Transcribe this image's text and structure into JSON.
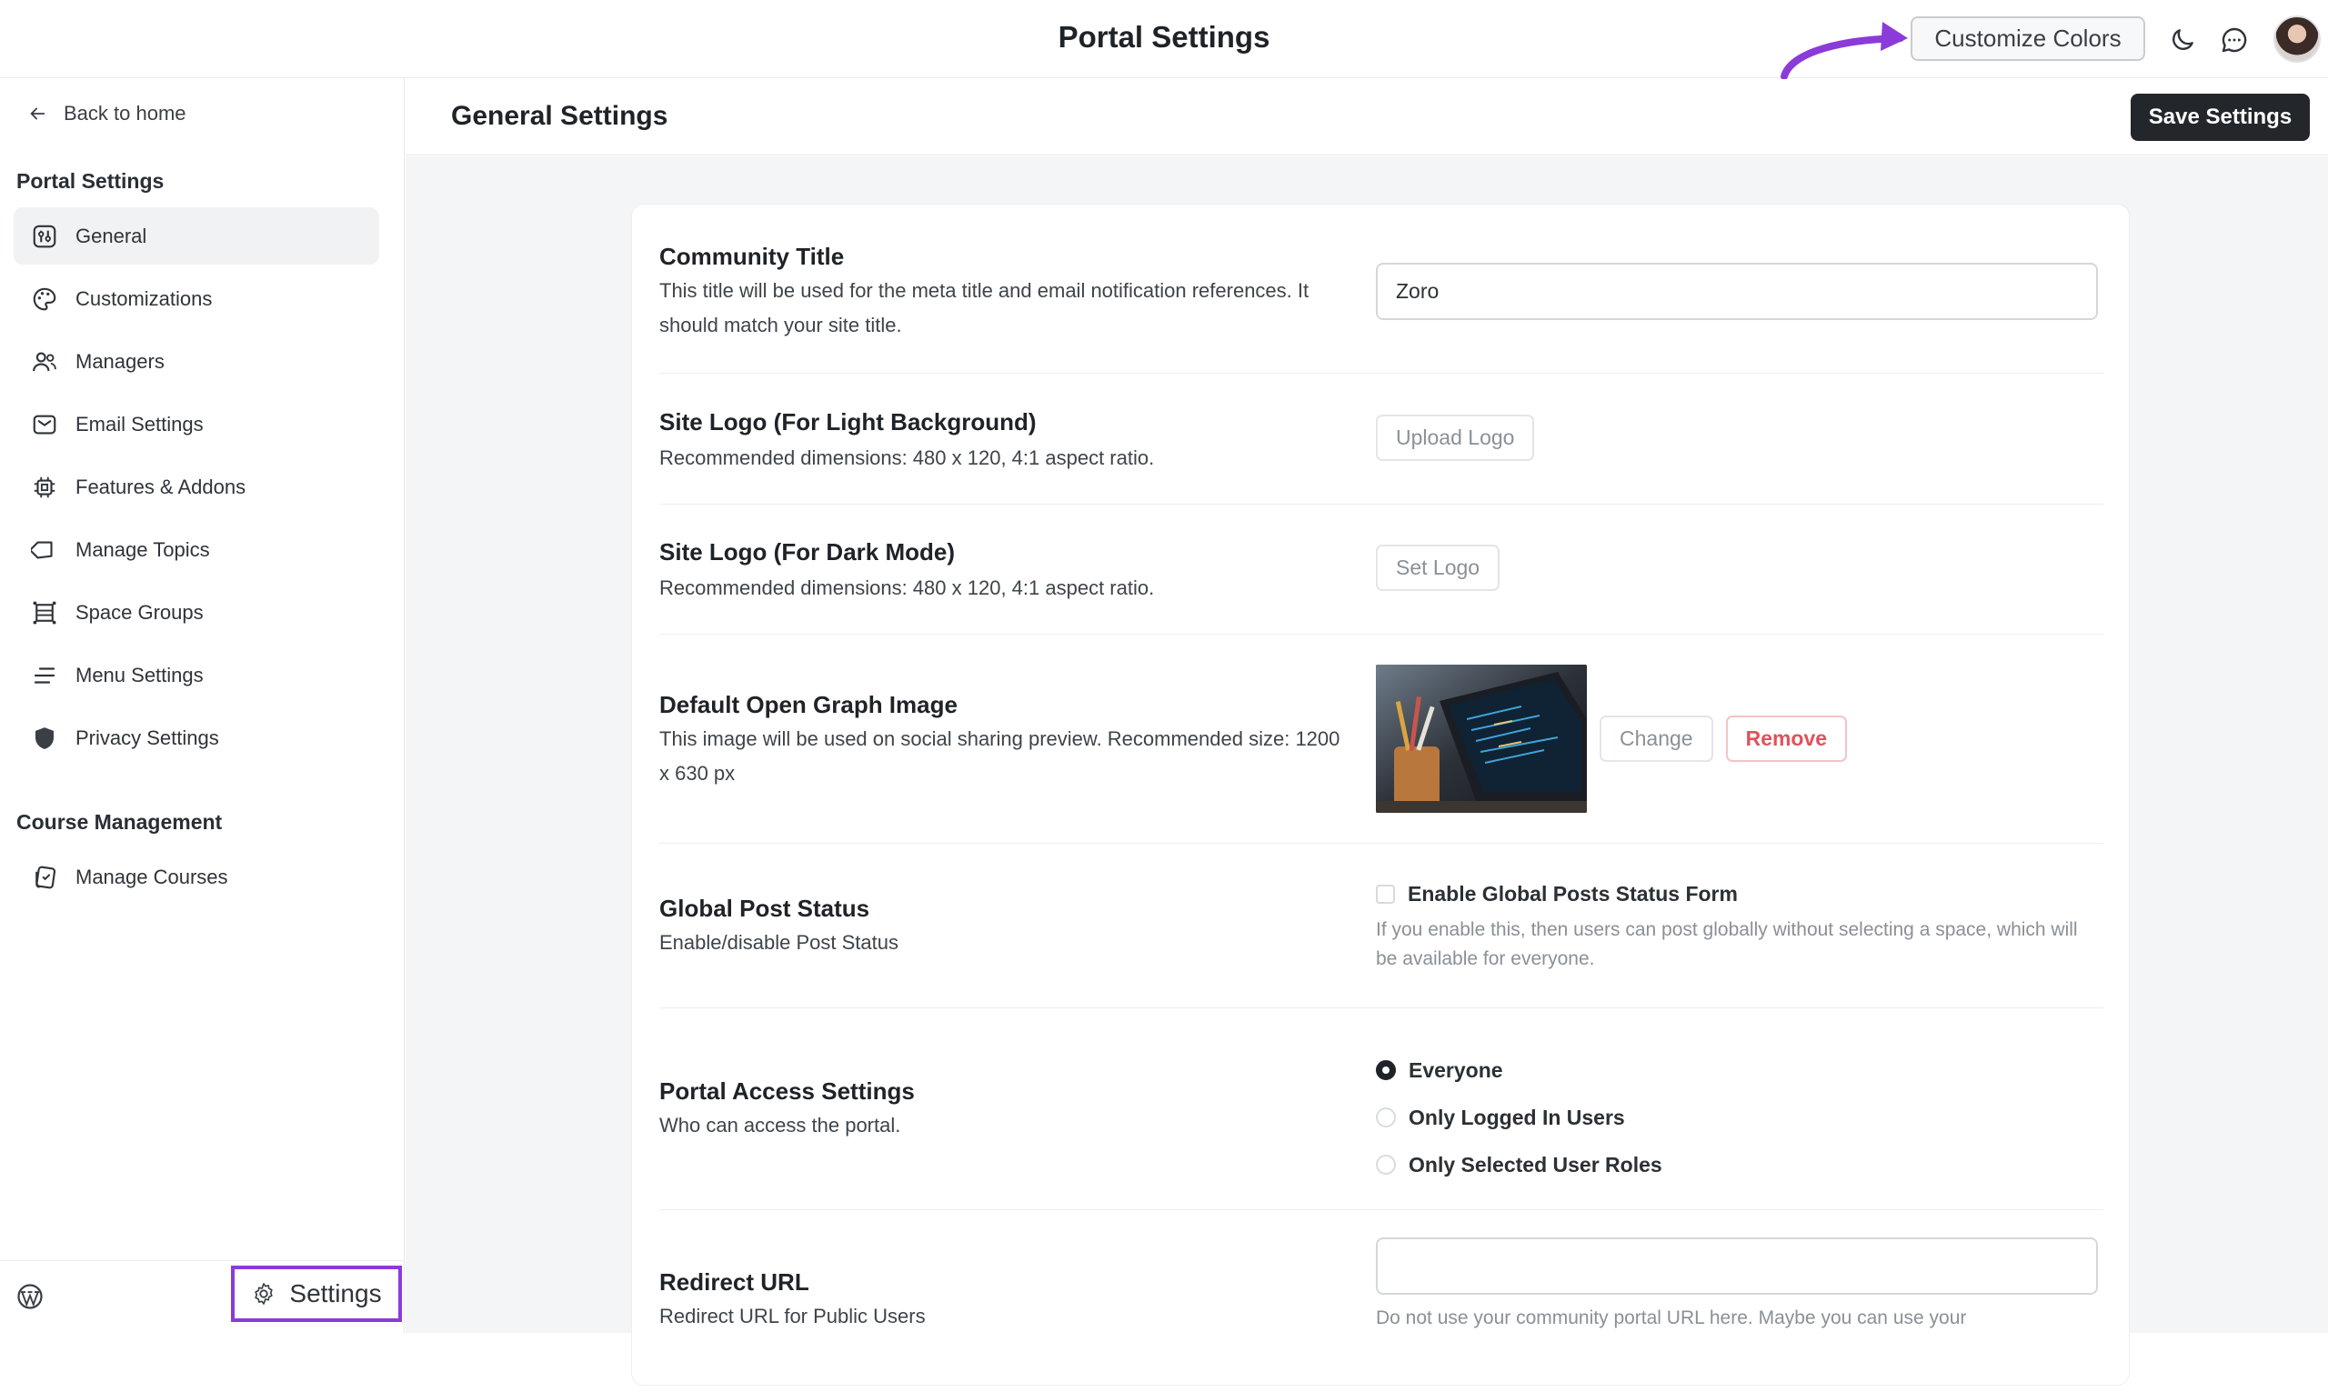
{
  "topbar": {
    "title": "Portal Settings",
    "customize_colors": "Customize Colors",
    "icons": [
      "moon-icon",
      "chat-icon",
      "user-avatar"
    ]
  },
  "sidebar": {
    "back_label": "Back to home",
    "portal_heading": "Portal Settings",
    "items": [
      {
        "label": "General",
        "icon": "sliders-icon"
      },
      {
        "label": "Customizations",
        "icon": "palette-icon"
      },
      {
        "label": "Managers",
        "icon": "users-icon"
      },
      {
        "label": "Email Settings",
        "icon": "mail-icon"
      },
      {
        "label": "Features & Addons",
        "icon": "chip-icon"
      },
      {
        "label": "Manage Topics",
        "icon": "tag-icon"
      },
      {
        "label": "Space Groups",
        "icon": "grid-icon"
      },
      {
        "label": "Menu Settings",
        "icon": "menu-icon"
      },
      {
        "label": "Privacy Settings",
        "icon": "shield-icon"
      }
    ],
    "course_heading": "Course Management",
    "course_items": [
      {
        "label": "Manage Courses",
        "icon": "courses-icon"
      }
    ],
    "footer_settings": "Settings"
  },
  "header": {
    "title": "General Settings",
    "save_label": "Save Settings"
  },
  "form": {
    "community_title": {
      "label": "Community Title",
      "desc": "This title will be used for the meta title and email notification references. It should match your site title.",
      "value": "Zoro"
    },
    "logo_light": {
      "label": "Site Logo (For Light Background)",
      "desc": "Recommended dimensions: 480 x 120, 4:1 aspect ratio.",
      "button": "Upload Logo"
    },
    "logo_dark": {
      "label": "Site Logo (For Dark Mode)",
      "desc": "Recommended dimensions: 480 x 120, 4:1 aspect ratio.",
      "button": "Set Logo"
    },
    "og_image": {
      "label": "Default Open Graph Image",
      "desc": "This image will be used on social sharing preview. Recommended size: 1200 x 630 px",
      "change": "Change",
      "remove": "Remove"
    },
    "global_post": {
      "label": "Global Post Status",
      "desc": "Enable/disable Post Status",
      "checkbox_label": "Enable Global Posts Status Form",
      "checked": false,
      "hint": "If you enable this, then users can post globally without selecting a space, which will be available for everyone."
    },
    "portal_access": {
      "label": "Portal Access Settings",
      "desc": "Who can access the portal.",
      "options": [
        "Everyone",
        "Only Logged In Users",
        "Only Selected User Roles"
      ],
      "selected": "Everyone"
    },
    "redirect": {
      "label": "Redirect URL",
      "desc": "Redirect URL for Public Users",
      "value": "",
      "hint": "Do not use your community portal URL here. Maybe you can use your"
    }
  },
  "colors": {
    "accent_purple": "#8b3bd9",
    "primary_dark": "#23272c",
    "danger": "#e0525b"
  }
}
